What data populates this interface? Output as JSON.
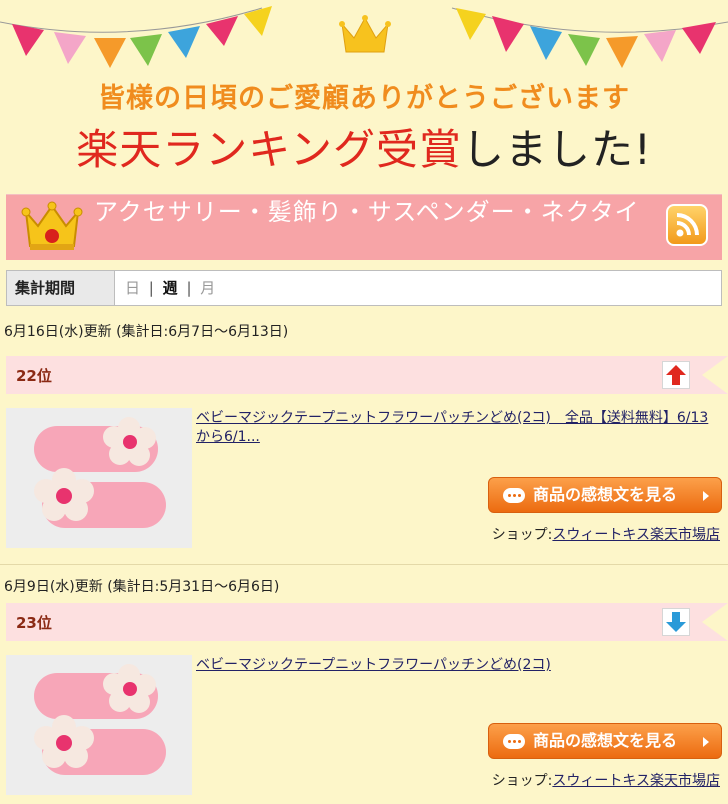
{
  "banner": {
    "line1": "皆様の日頃のご愛顧ありがとうございます",
    "line2_red": "楽天ランキング受賞",
    "line2_black": "しました!"
  },
  "category": {
    "title": "アクセサリー・髪飾り・サスペンダー・ネクタイ",
    "icon": "rss-icon"
  },
  "period": {
    "label": "集計期間",
    "day": "日",
    "week": "週",
    "month": "月",
    "separator": "|"
  },
  "entries": [
    {
      "date_line": "6月16日(水)更新 (集計日:6月7日～6月13日)",
      "rank": "22位",
      "arrow": "up",
      "product_link": "ベビーマジックテープニットフラワーパッチンどめ(2コ)　全品【送料無料】6/13から6/1...",
      "review_button": "商品の感想文を見る",
      "shop_label": "ショップ:",
      "shop_name": "スウィートキス楽天市場店"
    },
    {
      "date_line": "6月9日(水)更新 (集計日:5月31日～6月6日)",
      "rank": "23位",
      "arrow": "down",
      "product_link": "ベビーマジックテープニットフラワーパッチンどめ(2コ)",
      "review_button": "商品の感想文を見る",
      "shop_label": "ショップ:",
      "shop_name": "スウィートキス楽天市場店"
    }
  ],
  "colors": {
    "background": "#fdf6c9",
    "category_bar": "#f7a4a7",
    "rank_bar": "#fde0e0",
    "button_orange": "#ec6b10",
    "arrow_up": "#e0281e",
    "arrow_down": "#2a9ad8"
  }
}
